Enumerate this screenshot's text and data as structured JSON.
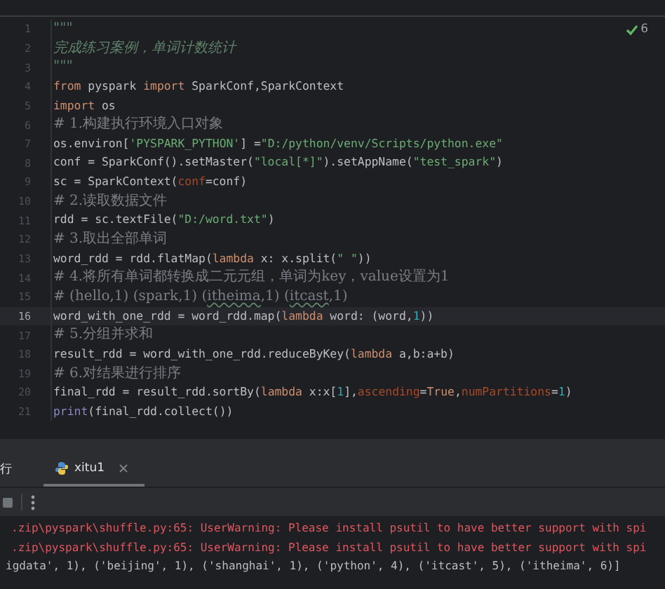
{
  "editor": {
    "inspection": {
      "count": "6"
    },
    "lines": [
      {
        "number": "1",
        "current": false,
        "tokens": [
          {
            "text": "\"\"\"",
            "kind": "doc"
          }
        ]
      },
      {
        "number": "2",
        "current": false,
        "tokens": [
          {
            "text": "完成练习案例，单词计数统计",
            "kind": "doc"
          }
        ]
      },
      {
        "number": "3",
        "current": false,
        "tokens": [
          {
            "text": "\"\"\"",
            "kind": "doc"
          }
        ]
      },
      {
        "number": "4",
        "current": false,
        "tokens": [
          {
            "text": "from",
            "kind": "keyword"
          },
          {
            "text": " pyspark ",
            "kind": "plain"
          },
          {
            "text": "import",
            "kind": "keyword"
          },
          {
            "text": " SparkConf,SparkContext",
            "kind": "plain"
          }
        ]
      },
      {
        "number": "5",
        "current": false,
        "tokens": [
          {
            "text": "import",
            "kind": "keyword"
          },
          {
            "text": " os",
            "kind": "plain"
          }
        ]
      },
      {
        "number": "6",
        "current": false,
        "tokens": [
          {
            "text": "# 1.构建执行环境入口对象",
            "kind": "comment"
          }
        ]
      },
      {
        "number": "7",
        "current": false,
        "tokens": [
          {
            "text": "os.environ[",
            "kind": "plain"
          },
          {
            "text": "'PYSPARK_PYTHON'",
            "kind": "string"
          },
          {
            "text": "] =",
            "kind": "plain"
          },
          {
            "text": "\"D:/python/venv/Scripts/python.exe\"",
            "kind": "string"
          }
        ]
      },
      {
        "number": "8",
        "current": false,
        "tokens": [
          {
            "text": "conf = SparkConf().setMaster(",
            "kind": "plain"
          },
          {
            "text": "\"local[*]\"",
            "kind": "string"
          },
          {
            "text": ").setAppName(",
            "kind": "plain"
          },
          {
            "text": "\"test_spark\"",
            "kind": "string"
          },
          {
            "text": ")",
            "kind": "plain"
          }
        ]
      },
      {
        "number": "9",
        "current": false,
        "tokens": [
          {
            "text": "sc = SparkContext(",
            "kind": "plain"
          },
          {
            "text": "conf",
            "kind": "param"
          },
          {
            "text": "=conf)",
            "kind": "plain"
          }
        ]
      },
      {
        "number": "10",
        "current": false,
        "tokens": [
          {
            "text": "# 2.读取数据文件",
            "kind": "comment"
          }
        ]
      },
      {
        "number": "11",
        "current": false,
        "tokens": [
          {
            "text": "rdd = sc.textFile(",
            "kind": "plain"
          },
          {
            "text": "\"D:/word.txt\"",
            "kind": "string"
          },
          {
            "text": ")",
            "kind": "plain"
          }
        ]
      },
      {
        "number": "12",
        "current": false,
        "tokens": [
          {
            "text": "# 3.取出全部单词",
            "kind": "comment"
          }
        ]
      },
      {
        "number": "13",
        "current": false,
        "tokens": [
          {
            "text": "word_rdd = rdd.flatMap(",
            "kind": "plain"
          },
          {
            "text": "lambda",
            "kind": "keyword"
          },
          {
            "text": " x: x.split(",
            "kind": "plain"
          },
          {
            "text": "\" \"",
            "kind": "string"
          },
          {
            "text": "))",
            "kind": "plain"
          }
        ]
      },
      {
        "number": "14",
        "current": false,
        "tokens": [
          {
            "text": "# 4.将所有单词都转换成二元元组，单词为key，value设置为1",
            "kind": "comment"
          }
        ]
      },
      {
        "number": "15",
        "current": false,
        "tokens": [
          {
            "text": "# (hello,1) (spark,1) (",
            "kind": "comment"
          },
          {
            "text": "itheima",
            "kind": "typo"
          },
          {
            "text": ",1) (",
            "kind": "comment"
          },
          {
            "text": "itcast",
            "kind": "typo"
          },
          {
            "text": ",1)",
            "kind": "comment"
          }
        ]
      },
      {
        "number": "16",
        "current": true,
        "tokens": [
          {
            "text": "word_with_one_rdd = word_rdd.map(",
            "kind": "plain"
          },
          {
            "text": "lambda",
            "kind": "keyword"
          },
          {
            "text": " word: (word,",
            "kind": "plain"
          },
          {
            "text": "1",
            "kind": "number"
          },
          {
            "text": "))",
            "kind": "plain"
          }
        ]
      },
      {
        "number": "17",
        "current": false,
        "tokens": [
          {
            "text": "# 5.分组并求和",
            "kind": "comment"
          }
        ]
      },
      {
        "number": "18",
        "current": false,
        "tokens": [
          {
            "text": "result_rdd = word_with_one_rdd.reduceByKey(",
            "kind": "plain"
          },
          {
            "text": "lambda",
            "kind": "keyword"
          },
          {
            "text": " a,b:a+b)",
            "kind": "plain"
          }
        ]
      },
      {
        "number": "19",
        "current": false,
        "tokens": [
          {
            "text": "# 6.对结果进行排序",
            "kind": "comment"
          }
        ]
      },
      {
        "number": "20",
        "current": false,
        "tokens": [
          {
            "text": "final_rdd = result_rdd.sortBy(",
            "kind": "plain"
          },
          {
            "text": "lambda",
            "kind": "keyword"
          },
          {
            "text": " x:x[",
            "kind": "plain"
          },
          {
            "text": "1",
            "kind": "number"
          },
          {
            "text": "],",
            "kind": "plain"
          },
          {
            "text": "ascending",
            "kind": "param"
          },
          {
            "text": "=",
            "kind": "plain"
          },
          {
            "text": "True",
            "kind": "keyword"
          },
          {
            "text": ",",
            "kind": "plain"
          },
          {
            "text": "numPartitions",
            "kind": "param"
          },
          {
            "text": "=",
            "kind": "plain"
          },
          {
            "text": "1",
            "kind": "number"
          },
          {
            "text": ")",
            "kind": "plain"
          }
        ]
      },
      {
        "number": "21",
        "current": false,
        "tokens": [
          {
            "text": "print",
            "kind": "builtin"
          },
          {
            "text": "(final_rdd.collect())",
            "kind": "plain"
          }
        ]
      }
    ]
  },
  "run_panel": {
    "tabs": [
      {
        "label": "行",
        "kind": "plain",
        "selected": false
      },
      {
        "label": "xitu1",
        "kind": "python",
        "selected": true
      }
    ],
    "console": [
      {
        "text": ".zip\\pyspark\\shuffle.py:65: UserWarning: Please install psutil to have better support with spi",
        "kind": "error"
      },
      {
        "text": ".zip\\pyspark\\shuffle.py:65: UserWarning: Please install psutil to have better support with spi",
        "kind": "error"
      },
      {
        "text": "igdata', 1), ('beijing', 1), ('shanghai', 1), ('python', 4), ('itcast', 5), ('itheima', 6)]",
        "kind": "output"
      }
    ]
  }
}
